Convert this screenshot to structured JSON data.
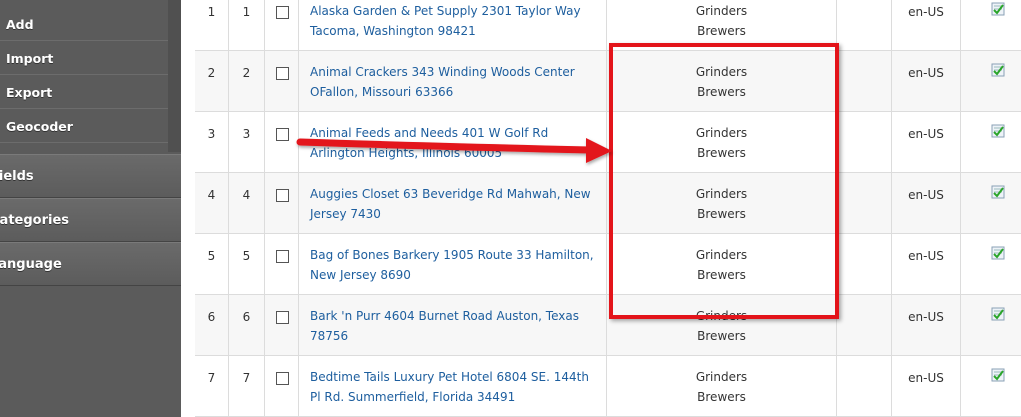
{
  "sidebar": {
    "sub_items": [
      {
        "label": "Add",
        "icon": "add"
      },
      {
        "label": "Import",
        "icon": "import"
      },
      {
        "label": "Export",
        "icon": "export"
      },
      {
        "label": "Geocoder",
        "icon": "geocoder"
      }
    ],
    "top_items": [
      {
        "label": "Fields"
      },
      {
        "label": "Categories"
      },
      {
        "label": "Language"
      }
    ]
  },
  "table": {
    "rows": [
      {
        "id": "1",
        "order": "1",
        "name": "Alaska Garden & Pet Supply 2301 Taylor Way Tacoma, Washington 98421",
        "categories": [
          "Grinders",
          "Brewers"
        ],
        "language": "en-US"
      },
      {
        "id": "2",
        "order": "2",
        "name": "Animal Crackers 343 Winding Woods Center OFallon, Missouri 63366",
        "categories": [
          "Grinders",
          "Brewers"
        ],
        "language": "en-US"
      },
      {
        "id": "3",
        "order": "3",
        "name": "Animal Feeds and Needs 401 W Golf Rd Arlington Heights, Illinois 60005",
        "categories": [
          "Grinders",
          "Brewers"
        ],
        "language": "en-US"
      },
      {
        "id": "4",
        "order": "4",
        "name": "Auggies Closet 63 Beveridge Rd Mahwah, New Jersey 7430",
        "categories": [
          "Grinders",
          "Brewers"
        ],
        "language": "en-US"
      },
      {
        "id": "5",
        "order": "5",
        "name": "Bag of Bones Barkery 1905 Route 33 Hamilton, New Jersey 8690",
        "categories": [
          "Grinders",
          "Brewers"
        ],
        "language": "en-US"
      },
      {
        "id": "6",
        "order": "6",
        "name": "Bark 'n Purr 4604 Burnet Road Auston, Texas 78756",
        "categories": [
          "Grinders",
          "Brewers"
        ],
        "language": "en-US"
      },
      {
        "id": "7",
        "order": "7",
        "name": "Bedtime Tails Luxury Pet Hotel 6804 SE. 144th Pl Rd. Summerfield, Florida 34491",
        "categories": [
          "Grinders",
          "Brewers"
        ],
        "language": "en-US"
      }
    ]
  },
  "colors": {
    "sidebar_bg": "#5b5b5b",
    "link": "#1d5e9e",
    "annotation_red": "#e3141a"
  }
}
